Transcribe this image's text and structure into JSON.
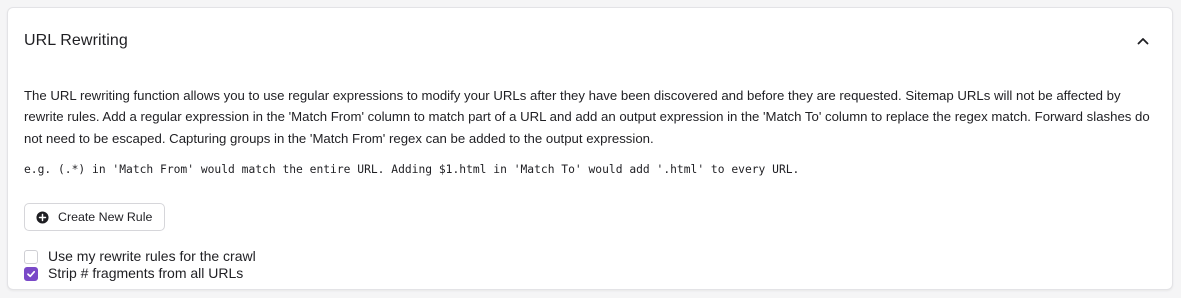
{
  "section": {
    "title": "URL Rewriting",
    "collapse_icon": "chevron-up-icon"
  },
  "description": "The URL rewriting function allows you to use regular expressions to modify your URLs after they have been discovered and before they are requested. Sitemap URLs will not be affected by rewrite rules. Add a regular expression in the 'Match From' column to match part of a URL and add an output expression in the 'Match To' column to replace the regex match. Forward slashes do not need to be escaped. Capturing groups in the 'Match From' regex can be added to the output expression.",
  "example": "e.g. (.*) in 'Match From' would match the entire URL. Adding $1.html in 'Match To' would add '.html' to every URL.",
  "create_button": {
    "label": "Create New Rule",
    "icon": "plus-circle-icon"
  },
  "options": [
    {
      "label": "Use my rewrite rules for the crawl",
      "checked": false
    },
    {
      "label": "Strip # fragments from all URLs",
      "checked": true
    }
  ],
  "colors": {
    "accent": "#7a49c8",
    "text": "#1f1f23",
    "border": "#e3e3e6"
  }
}
